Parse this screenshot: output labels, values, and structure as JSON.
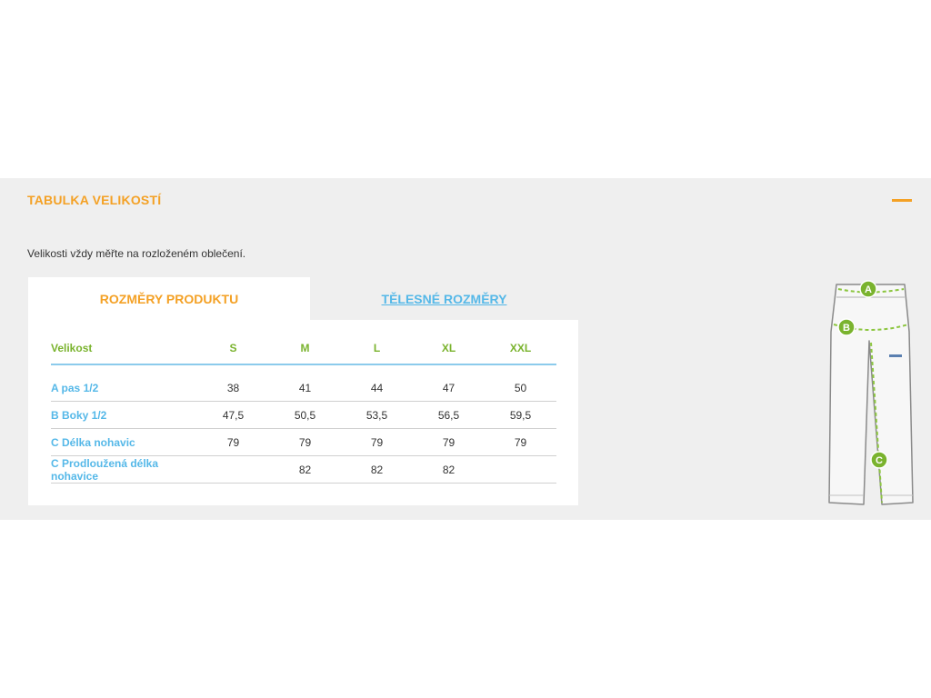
{
  "header": {
    "title": "TABULKA VELIKOSTÍ",
    "collapse_icon": "minus-icon",
    "accent_color": "#f4a125"
  },
  "note": "Velikosti vždy měřte na rozloženém oblečení.",
  "tabs": [
    {
      "label": "ROZMĚRY PRODUKTU",
      "active": true
    },
    {
      "label": "TĚLESNÉ ROZMĚRY",
      "active": false
    }
  ],
  "table": {
    "header": [
      "Velikost",
      "S",
      "M",
      "L",
      "XL",
      "XXL"
    ],
    "rows": [
      {
        "label": "A pas 1/2",
        "values": [
          "38",
          "41",
          "44",
          "47",
          "50"
        ]
      },
      {
        "label": "B Boky 1/2",
        "values": [
          "47,5",
          "50,5",
          "53,5",
          "56,5",
          "59,5"
        ]
      },
      {
        "label": "C Délka nohavic",
        "values": [
          "79",
          "79",
          "79",
          "79",
          "79"
        ]
      },
      {
        "label": "C Prodloužená délka nohavice",
        "values": [
          "",
          "82",
          "82",
          "82",
          ""
        ]
      }
    ]
  },
  "diagram": {
    "markers": [
      "A",
      "B",
      "C"
    ],
    "marker_color": "#7ab32e"
  }
}
